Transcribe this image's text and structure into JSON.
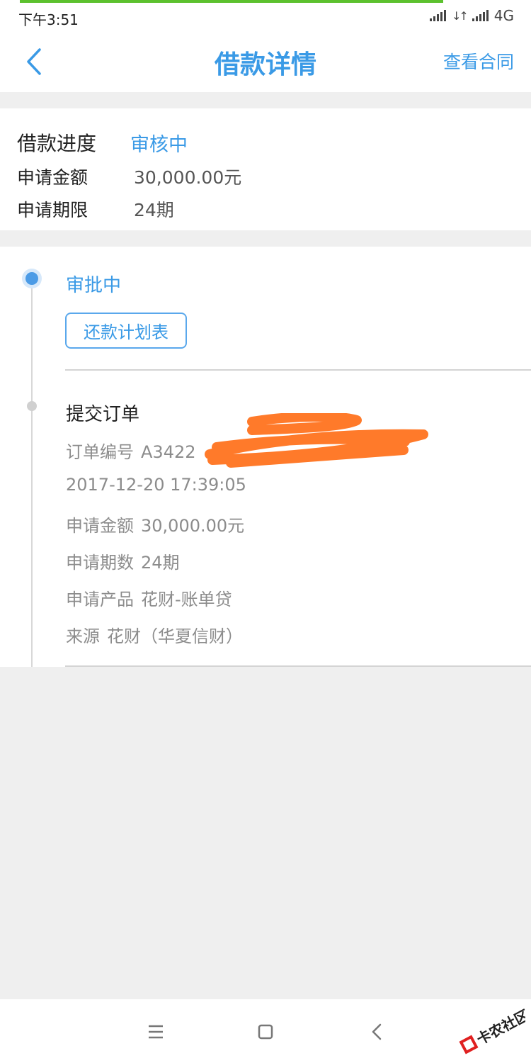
{
  "status_bar": {
    "time": "下午3:51",
    "network": "4G"
  },
  "header": {
    "title": "借款详情",
    "contract_link": "查看合同"
  },
  "summary": {
    "progress_label": "借款进度",
    "progress_value": "审核中",
    "amount_label": "申请金额",
    "amount_value": "30,000.00元",
    "term_label": "申请期限",
    "term_value": "24期"
  },
  "timeline": {
    "current_step": "审批中",
    "plan_button": "还款计划表",
    "submitted_step": "提交订单",
    "details": {
      "order_label": "订单编号",
      "order_value": "A3422",
      "time": "2017-12-20 17:39:05",
      "amount_label": "申请金额",
      "amount_value": "30,000.00元",
      "term_label": "申请期数",
      "term_value": "24期",
      "product_label": "申请产品",
      "product_value": "花财-账单贷",
      "source_label": "来源",
      "source_value": "花财（华夏信财）"
    }
  },
  "watermark": {
    "text": "卡农社区"
  },
  "colors": {
    "accent": "#3a9ae6",
    "scribble": "#ff7a2a",
    "loading_bar": "#5cc12e"
  }
}
